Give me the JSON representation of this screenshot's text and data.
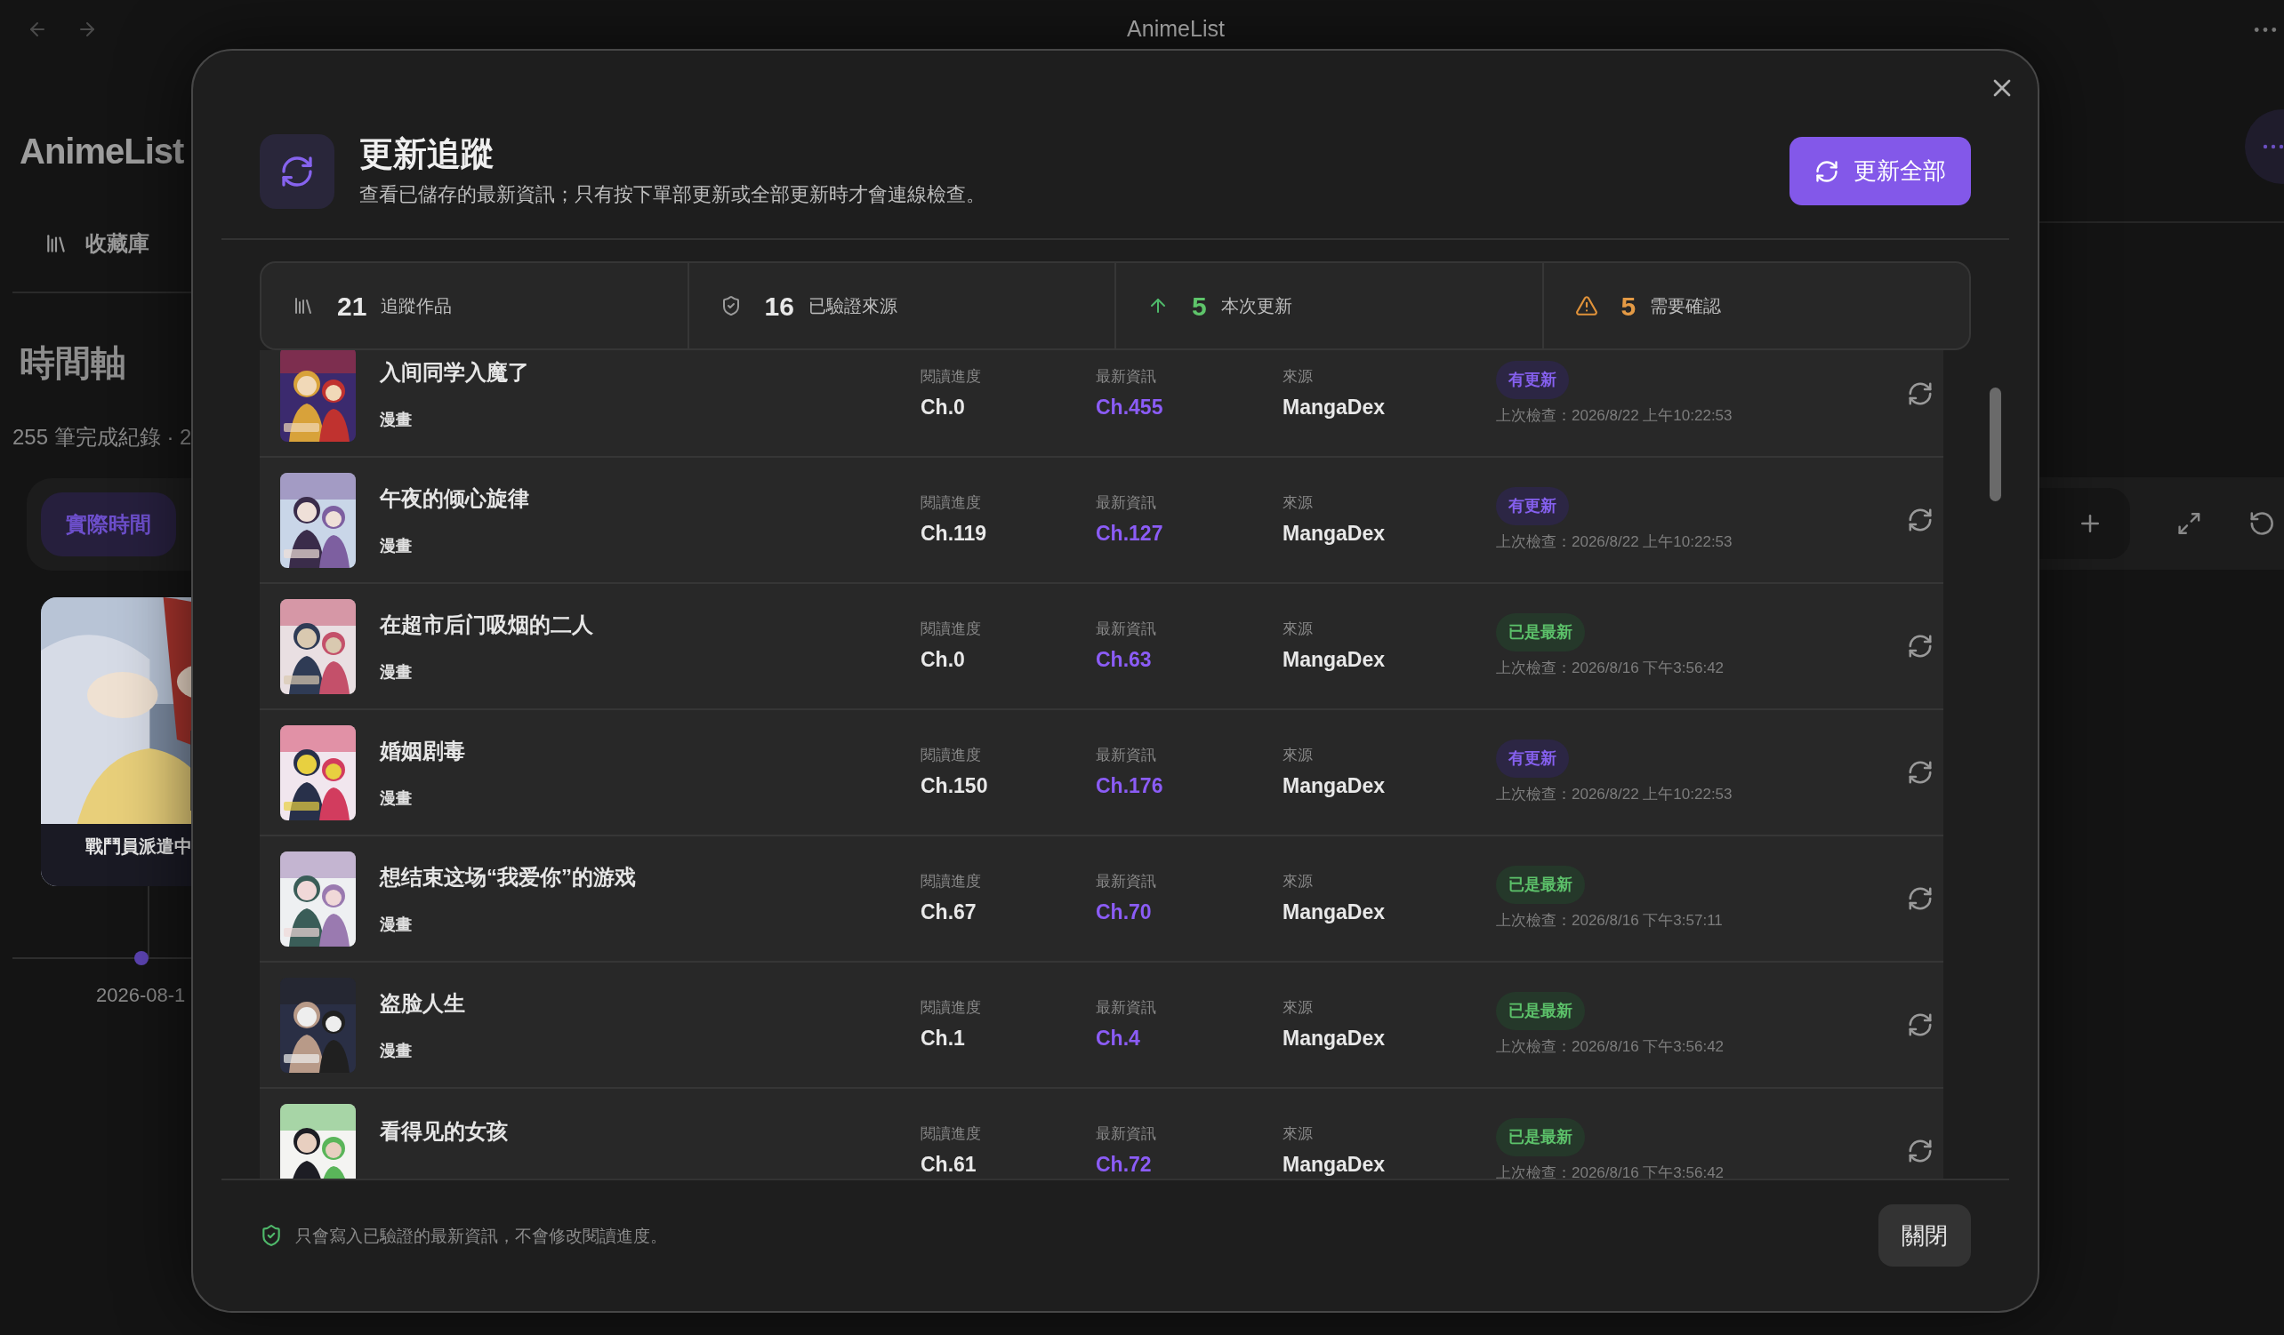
{
  "window": {
    "title": "AnimeList"
  },
  "sidebar": {
    "logo": "AnimeList",
    "nav": [
      {
        "label": "收藏庫"
      }
    ],
    "section_title": "時間軸",
    "summary": "255 筆完成紀錄 · 2",
    "segments": [
      {
        "label": "實際時間",
        "selected": true
      }
    ],
    "poster": {
      "caption": "戰鬥員派遣中"
    },
    "timeline_date": "2026-08-1"
  },
  "dialog": {
    "title": "更新追蹤",
    "subtitle": "查看已儲存的最新資訊；只有按下單部更新或全部更新時才會連線檢查。",
    "primary_button": "更新全部",
    "stats": [
      {
        "kind": "library",
        "value": "21",
        "label": "追蹤作品"
      },
      {
        "kind": "verified",
        "value": "16",
        "label": "已驗證來源"
      },
      {
        "kind": "up",
        "value": "5",
        "label": "本次更新"
      },
      {
        "kind": "warning",
        "value": "5",
        "label": "需要確認"
      }
    ],
    "rows": [
      {
        "title": "入间同学入魔了",
        "type": "漫畫",
        "progress_label": "閱讀進度",
        "progress": "Ch.0",
        "latest_label": "最新資訊",
        "latest": "Ch.455",
        "source_label": "來源",
        "source": "MangaDex",
        "badge": {
          "kind": "updated",
          "label": "有更新"
        },
        "checked": "上次檢查：2026/8/22 上午10:22:53"
      },
      {
        "title": "午夜的倾心旋律",
        "type": "漫畫",
        "progress_label": "閱讀進度",
        "progress": "Ch.119",
        "latest_label": "最新資訊",
        "latest": "Ch.127",
        "source_label": "來源",
        "source": "MangaDex",
        "badge": {
          "kind": "updated",
          "label": "有更新"
        },
        "checked": "上次檢查：2026/8/22 上午10:22:53"
      },
      {
        "title": "在超市后门吸烟的二人",
        "type": "漫畫",
        "progress_label": "閱讀進度",
        "progress": "Ch.0",
        "latest_label": "最新資訊",
        "latest": "Ch.63",
        "source_label": "來源",
        "source": "MangaDex",
        "badge": {
          "kind": "latest",
          "label": "已是最新"
        },
        "checked": "上次檢查：2026/8/16 下午3:56:42"
      },
      {
        "title": "婚姻剧毒",
        "type": "漫畫",
        "progress_label": "閱讀進度",
        "progress": "Ch.150",
        "latest_label": "最新資訊",
        "latest": "Ch.176",
        "source_label": "來源",
        "source": "MangaDex",
        "badge": {
          "kind": "updated",
          "label": "有更新"
        },
        "checked": "上次檢查：2026/8/22 上午10:22:53"
      },
      {
        "title": "想结束这场“我爱你”的游戏",
        "type": "漫畫",
        "progress_label": "閱讀進度",
        "progress": "Ch.67",
        "latest_label": "最新資訊",
        "latest": "Ch.70",
        "source_label": "來源",
        "source": "MangaDex",
        "badge": {
          "kind": "latest",
          "label": "已是最新"
        },
        "checked": "上次檢查：2026/8/16 下午3:57:11"
      },
      {
        "title": "盗脸人生",
        "type": "漫畫",
        "progress_label": "閱讀進度",
        "progress": "Ch.1",
        "latest_label": "最新資訊",
        "latest": "Ch.4",
        "source_label": "來源",
        "source": "MangaDex",
        "badge": {
          "kind": "latest",
          "label": "已是最新"
        },
        "checked": "上次檢查：2026/8/16 下午3:56:42"
      },
      {
        "title": "看得见的女孩",
        "progress_label": "閱讀進度",
        "progress": "Ch.61",
        "latest_label": "最新資訊",
        "latest": "Ch.72",
        "source_label": "來源",
        "source": "MangaDex",
        "badge": {
          "kind": "latest",
          "label": "已是最新"
        },
        "checked": "上次檢查：2026/8/16 下午3:56:42"
      }
    ],
    "footer_note": "只會寫入已驗證的最新資訊，不會修改閱讀進度。",
    "close_button": "關閉"
  }
}
